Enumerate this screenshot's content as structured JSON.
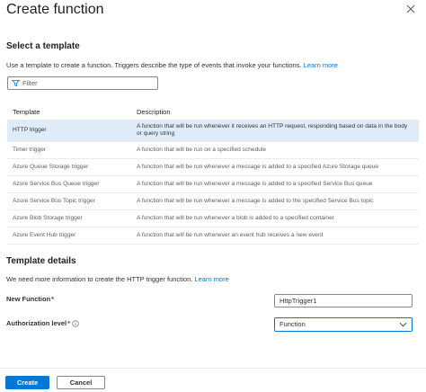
{
  "header": {
    "title": "Create function"
  },
  "template_section": {
    "heading": "Select a template",
    "description": "Use a template to create a function. Triggers describe the type of events that invoke your functions.",
    "learn_more": "Learn more",
    "filter_placeholder": "Filter",
    "columns": {
      "template": "Template",
      "description": "Description"
    },
    "rows": [
      {
        "name": "HTTP trigger",
        "description": "A function that will be run whenever it receives an HTTP request, responding based on data in the body or query string",
        "selected": true
      },
      {
        "name": "Timer trigger",
        "description": "A function that will be run on a specified schedule",
        "selected": false
      },
      {
        "name": "Azure Queue Storage trigger",
        "description": "A function that will be run whenever a message is added to a specified Azure Storage queue",
        "selected": false
      },
      {
        "name": "Azure Service Bus Queue trigger",
        "description": "A function that will be run whenever a message is added to a specified Service Bus queue",
        "selected": false
      },
      {
        "name": "Azure Service Bus Topic trigger",
        "description": "A function that will be run whenever a message is added to the specified Service Bus topic",
        "selected": false
      },
      {
        "name": "Azure Blob Storage trigger",
        "description": "A function that will be run whenever a blob is added to a specified container",
        "selected": false
      },
      {
        "name": "Azure Event Hub trigger",
        "description": "A function that will be run whenever an event hub receives a new event",
        "selected": false
      }
    ]
  },
  "details_section": {
    "heading": "Template details",
    "description": "We need more information to create the HTTP trigger function.",
    "learn_more": "Learn more",
    "new_function_label": "New Function",
    "new_function_value": "HttpTrigger1",
    "auth_label": "Authorization level",
    "auth_value": "Function",
    "required_mark": "*"
  },
  "footer": {
    "create_label": "Create",
    "cancel_label": "Cancel"
  },
  "colors": {
    "accent": "#0078d4",
    "selected_row": "#deecf9",
    "required": "#a4262c"
  }
}
